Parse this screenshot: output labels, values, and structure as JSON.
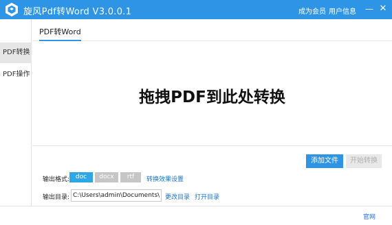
{
  "window": {
    "title": "旋风Pdf转Word  V3.0.0.1",
    "member_label": "成为会员",
    "userinfo_label": "用户信息",
    "min_symbol": "—",
    "close_symbol": "✕"
  },
  "sidebar": {
    "items": [
      {
        "label": "PDF转换",
        "active": true
      },
      {
        "label": "PDF操作",
        "active": false
      }
    ]
  },
  "tabs": [
    {
      "label": "PDF转Word",
      "active": true
    }
  ],
  "dropzone": {
    "text": "拖拽PDF到此处转换"
  },
  "actions": {
    "add_file": "添加文件",
    "start_convert": "开始转换"
  },
  "output": {
    "format_label": "输出格式:",
    "formats": [
      "doc",
      "docx",
      "rtf"
    ],
    "selected_format": "doc",
    "effect_settings": "转换效果设置",
    "dir_label": "输出目录:",
    "dir_value": "C:\\Users\\admin\\Documents\\Xu",
    "change_dir": "更改目录",
    "open_dir": "打开目录"
  },
  "footer": {
    "website": "官网"
  },
  "colors": {
    "titlebar": "#2e95e6",
    "accent": "#2e95e6",
    "link": "#1a73c9",
    "disabled": "#c6c6c6"
  },
  "icons": {
    "logo": "app-logo-icon"
  }
}
